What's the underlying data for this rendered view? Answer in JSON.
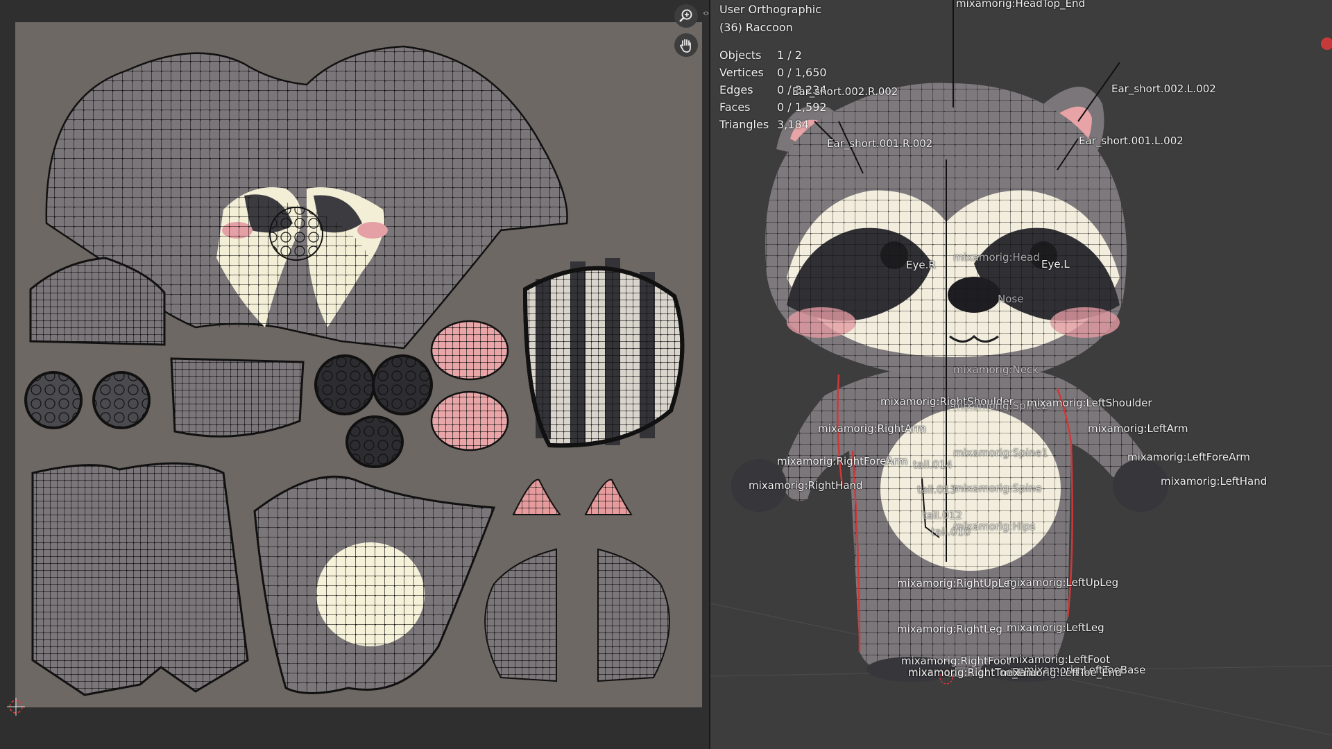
{
  "viewport": {
    "view_name": "User Orthographic",
    "object_label": "(36) Raccoon",
    "stats": [
      {
        "key": "Objects",
        "value": "1 / 2"
      },
      {
        "key": "Vertices",
        "value": "0 / 1,650"
      },
      {
        "key": "Edges",
        "value": "0 / 3,234"
      },
      {
        "key": "Faces",
        "value": "0 / 1,592"
      },
      {
        "key": "Triangles",
        "value": "3,184"
      }
    ],
    "bone_labels": [
      "mixamorig:HeadTop_End",
      "Ear_short.002.R.002",
      "Ear_short.002.L.002",
      "Ear_short.001.R.002",
      "Ear_short.001.L.002",
      "Eye.R",
      "mixamorig:Head",
      "Eye.L",
      "Nose",
      "mixamorig:Neck",
      "mixamorig:RightShoulder",
      "mixamorig:Spine2",
      "mixamorig:LeftShoulder",
      "mixamorig:RightArm",
      "mixamorig:LeftArm",
      "mixamorig:Spine1",
      "mixamorig:RightForeArm",
      "tail.014",
      "mixamorig:LeftForeArm",
      "mixamorig:RightHand",
      "tail.013",
      "mixamorig:Spine",
      "mixamorig:LeftHand",
      "tail.012",
      "mixamorig:Hips",
      "tail.010",
      "mixamorig:RightUpLeg",
      "mixamorig:LeftUpLeg",
      "mixamorig:RightLeg",
      "mixamorig:LeftLeg",
      "mixamorig:RightFoot",
      "mixamorig:LeftFoot",
      "mixamorig:RightToeBase",
      "mixamorig:LeftToeBase",
      "mixamorig:RightToe_End",
      "mixamorig:LeftToe_End"
    ]
  },
  "uv_editor": {
    "zoom_icon": "zoom-magnifier-icon",
    "pan_icon": "hand-pan-icon",
    "cursor_icon": "2d-cursor-icon"
  },
  "colors": {
    "uv_background": "#6e6864",
    "mesh_gray": "#7a7577",
    "mesh_dark": "#3a3a3e",
    "cream": "#f4efd8",
    "pink": "#e8a3a6",
    "seam_red": "#d23a3a"
  }
}
